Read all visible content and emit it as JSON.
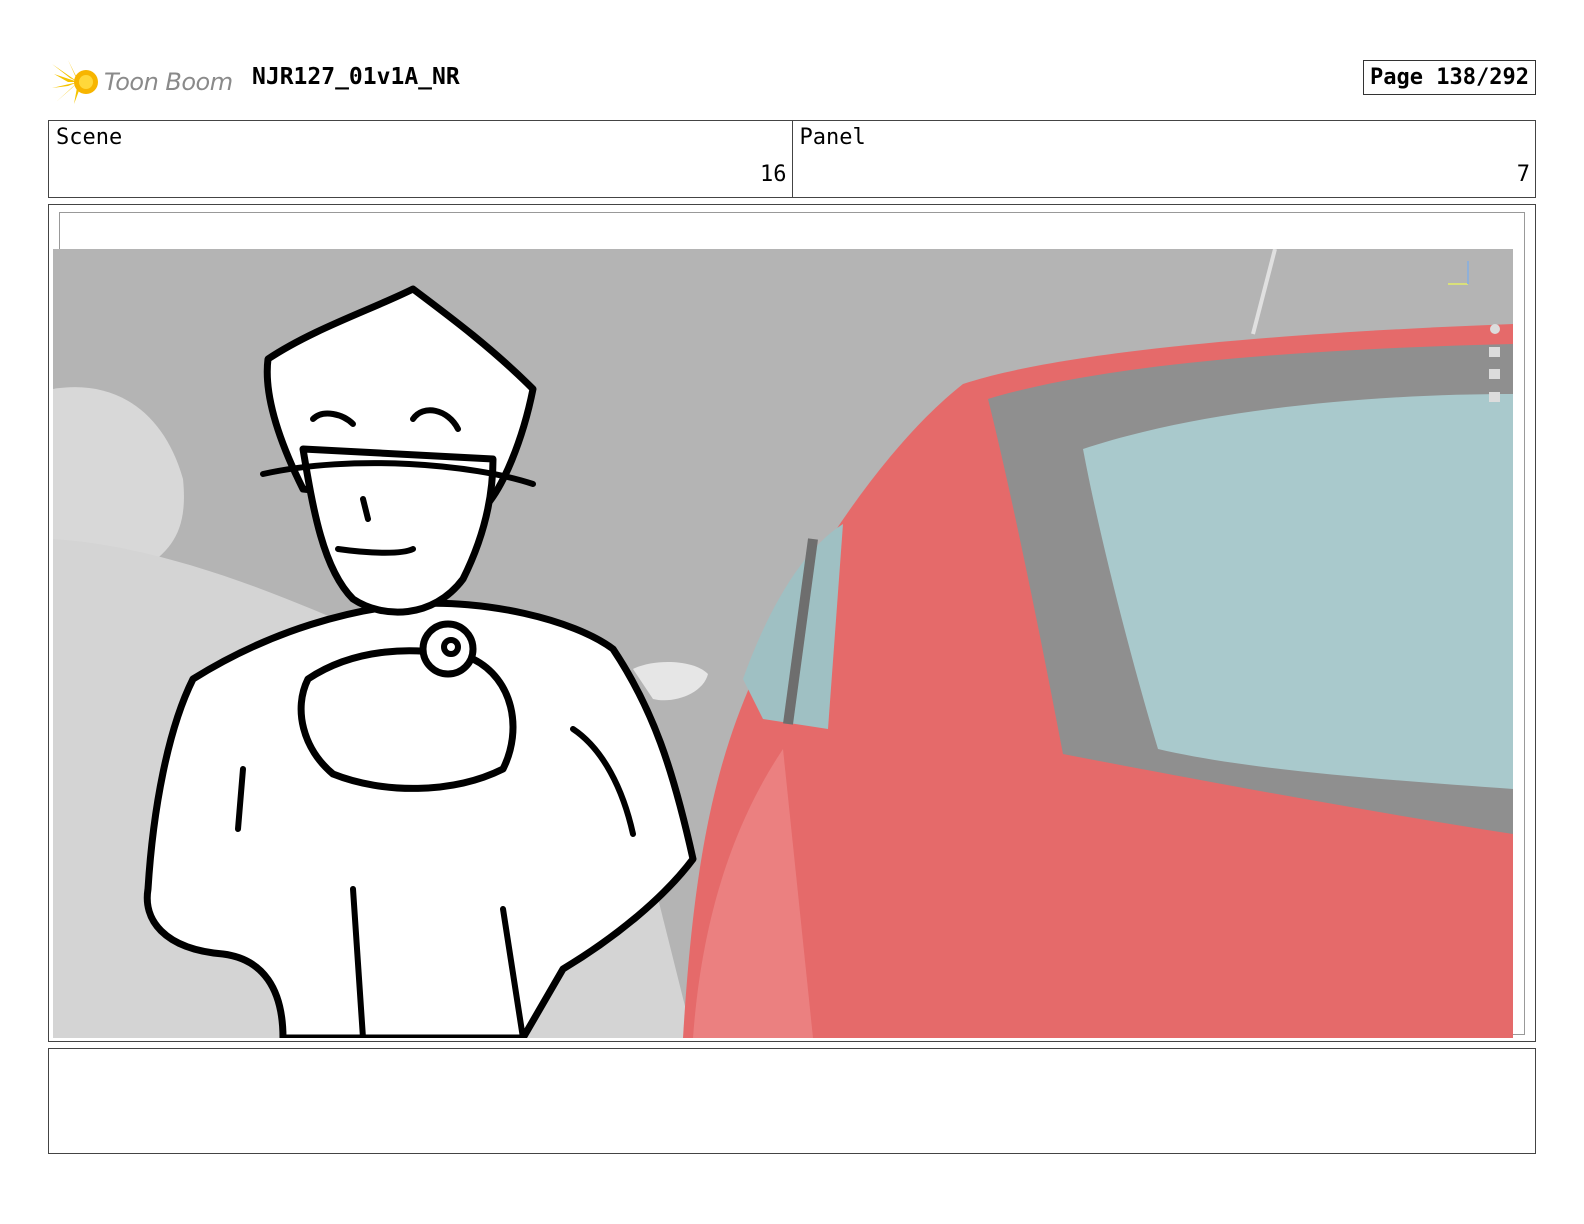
{
  "header": {
    "logo_text": "Toon Boom",
    "project": "NJR127_01v1A_NR",
    "page": "Page 138/292"
  },
  "info": {
    "scene_label": "Scene",
    "scene_value": "16",
    "panel_label": "Panel",
    "panel_value": "7"
  },
  "panel_image": {
    "subject": "character-holding-object-beside-red-car"
  },
  "notes": {
    "text": ""
  },
  "colors": {
    "logo_yellow": "#f5c400",
    "car_red": "#e24a4a",
    "background_gray": "#b4b4b4"
  }
}
